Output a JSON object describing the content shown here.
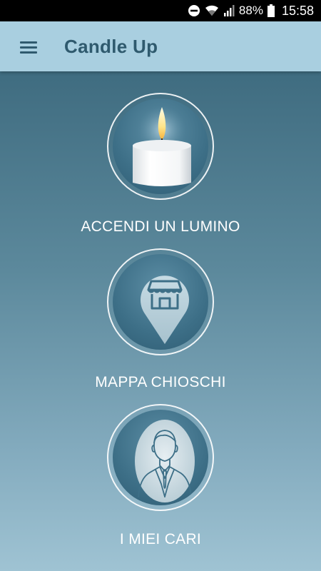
{
  "status_bar": {
    "battery_percent": "88%",
    "time": "15:58",
    "icons": [
      "do-not-disturb-icon",
      "wifi-icon",
      "signal-icon",
      "battery-icon"
    ]
  },
  "app_bar": {
    "title": "Candle Up",
    "menu_icon": "hamburger-menu-icon"
  },
  "menu": {
    "items": [
      {
        "label": "ACCENDI UN LUMINO",
        "icon": "candle-icon"
      },
      {
        "label": "MAPPA CHIOSCHI",
        "icon": "store-location-pin-icon"
      },
      {
        "label": "I MIEI CARI",
        "icon": "person-portrait-icon"
      }
    ]
  },
  "colors": {
    "app_bar_bg": "#a9cfe0",
    "title_color": "#2f5a6e",
    "background_top": "#3f6c80",
    "background_bottom": "#9fc3d3",
    "label_color": "#ffffff"
  }
}
